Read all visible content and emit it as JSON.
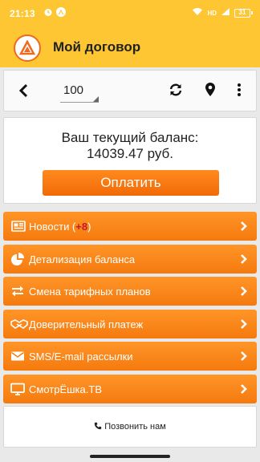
{
  "status_bar": {
    "time": "21:13",
    "network": "HD",
    "battery": "31"
  },
  "header": {
    "title": "Мой договор"
  },
  "toolbar": {
    "selected_contract": "100"
  },
  "balance": {
    "label": "Ваш текущий баланс:",
    "amount": "14039.47 руб.",
    "pay_button": "Оплатить"
  },
  "menu": {
    "items": [
      {
        "label": "Новости",
        "badge_open": " (",
        "badge": "+8",
        "badge_close": ")",
        "icon": "newspaper-icon"
      },
      {
        "label": "Детализация баланса",
        "icon": "pie-chart-icon"
      },
      {
        "label": "Смена тарифных планов",
        "icon": "exchange-icon"
      },
      {
        "label": "Доверительный платеж",
        "icon": "handshake-icon"
      },
      {
        "label": "SMS/E-mail рассылки",
        "icon": "envelope-icon"
      },
      {
        "label": "СмотрЁшка.ТВ",
        "icon": "tv-icon"
      }
    ]
  },
  "footer": {
    "call_label": "Позвонить нам"
  },
  "colors": {
    "header_bg": "#fdc632",
    "accent_orange": "#f57a0e",
    "badge_red": "#c5182a"
  }
}
